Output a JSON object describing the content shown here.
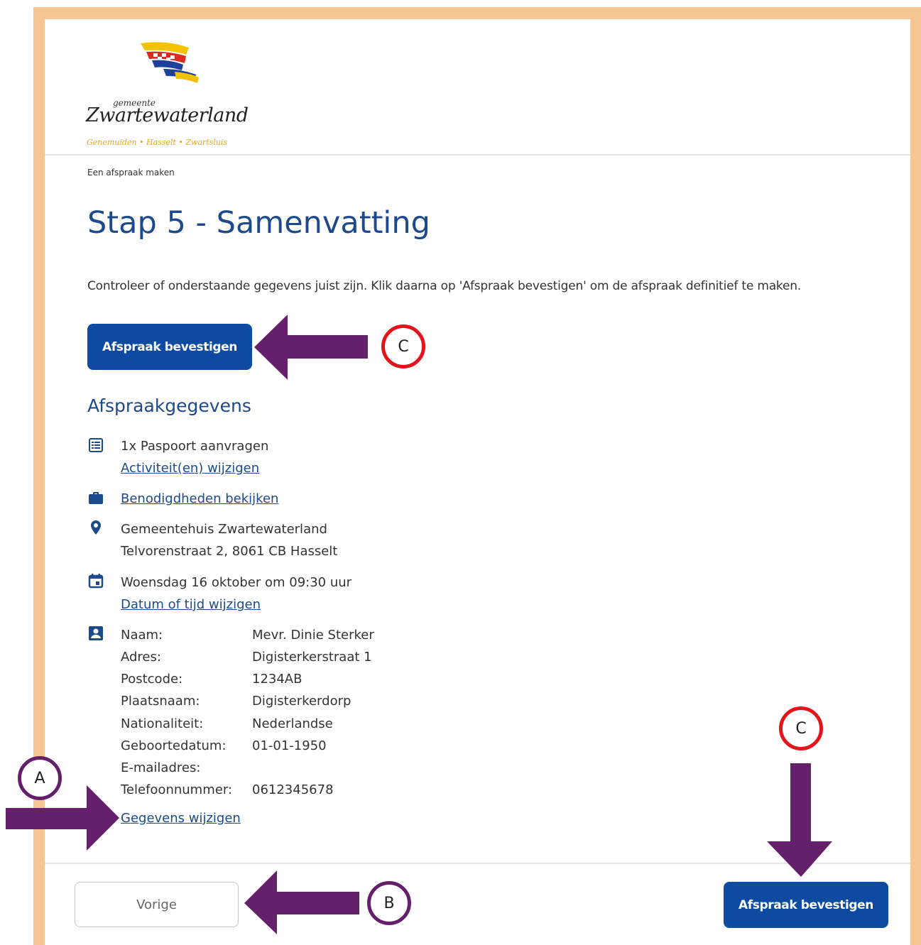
{
  "logo": {
    "small_text": "gemeente",
    "name": "Zwartewaterland",
    "places": "Genemuiden • Hasselt • Zwartsluis"
  },
  "breadcrumb": "Een afspraak maken",
  "page_title": "Stap 5 - Samenvatting",
  "intro": "Controleer of onderstaande gegevens juist zijn. Klik daarna op 'Afspraak bevestigen' om de afspraak definitief te maken.",
  "confirm_label": "Afspraak bevestigen",
  "section_title": "Afspraakgegevens",
  "activity": {
    "text": "1x Paspoort aanvragen",
    "link": "Activiteit(en) wijzigen",
    "icon": "list-icon"
  },
  "requirements": {
    "link": "Benodigdheden bekijken",
    "icon": "briefcase-icon"
  },
  "location": {
    "name": "Gemeentehuis Zwartewaterland",
    "address": "Telvorenstraat 2, 8061 CB Hasselt",
    "icon": "map-pin-icon"
  },
  "datetime": {
    "text": "Woensdag 16 oktober om 09:30 uur",
    "link": "Datum of tijd wijzigen",
    "icon": "calendar-icon"
  },
  "person": {
    "icon": "contact-card-icon",
    "fields": [
      {
        "label": "Naam:",
        "value": "Mevr. Dinie Sterker"
      },
      {
        "label": "Adres:",
        "value": "Digisterkerstraat 1"
      },
      {
        "label": "Postcode:",
        "value": "1234AB"
      },
      {
        "label": "Plaatsnaam:",
        "value": "Digisterkerdorp"
      },
      {
        "label": "Nationaliteit:",
        "value": "Nederlandse"
      },
      {
        "label": "Geboortedatum:",
        "value": "01-01-1950"
      },
      {
        "label": "E-mailadres:",
        "value": ""
      },
      {
        "label": "Telefoonnummer:",
        "value": "0612345678"
      }
    ],
    "edit_link": "Gegevens wijzigen"
  },
  "footer": {
    "prev_label": "Vorige",
    "confirm_label": "Afspraak bevestigen"
  },
  "annotations": {
    "a": "A",
    "b": "B",
    "c": "C"
  },
  "colors": {
    "frame": "#f5c691",
    "primary": "#0d4aa0",
    "heading": "#1c4a8a",
    "arrow": "#64206a",
    "badge_red": "#e3141b"
  }
}
